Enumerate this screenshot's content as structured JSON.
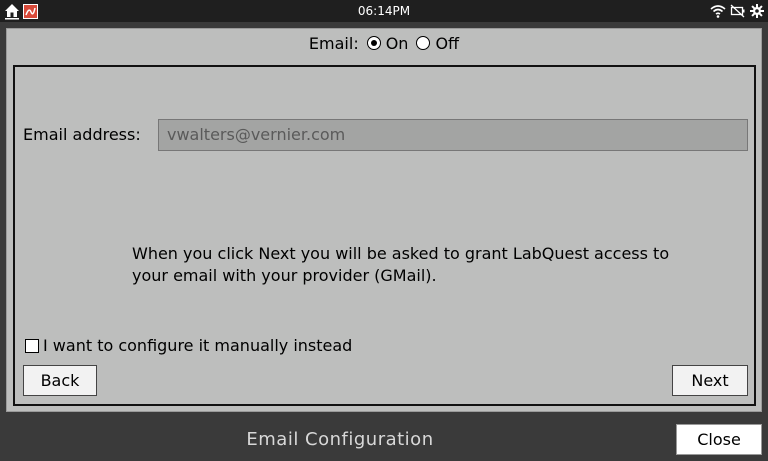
{
  "status": {
    "time": "06:14PM",
    "icons": [
      "home-icon",
      "app-icon",
      "wifi-icon",
      "no-battery-icon",
      "gear-icon"
    ]
  },
  "email_toggle": {
    "label": "Email:",
    "on_label": "On",
    "off_label": "Off",
    "selected": "On"
  },
  "form": {
    "address_label": "Email address:",
    "address_value": "vwalters@vernier.com",
    "info_text": "When you click Next you will be asked to grant LabQuest access to your email with your provider (GMail).",
    "manual_label": "I want to configure it manually instead",
    "manual_checked": false,
    "back_label": "Back",
    "next_label": "Next"
  },
  "footer": {
    "title": "Email Configuration",
    "close_label": "Close"
  }
}
